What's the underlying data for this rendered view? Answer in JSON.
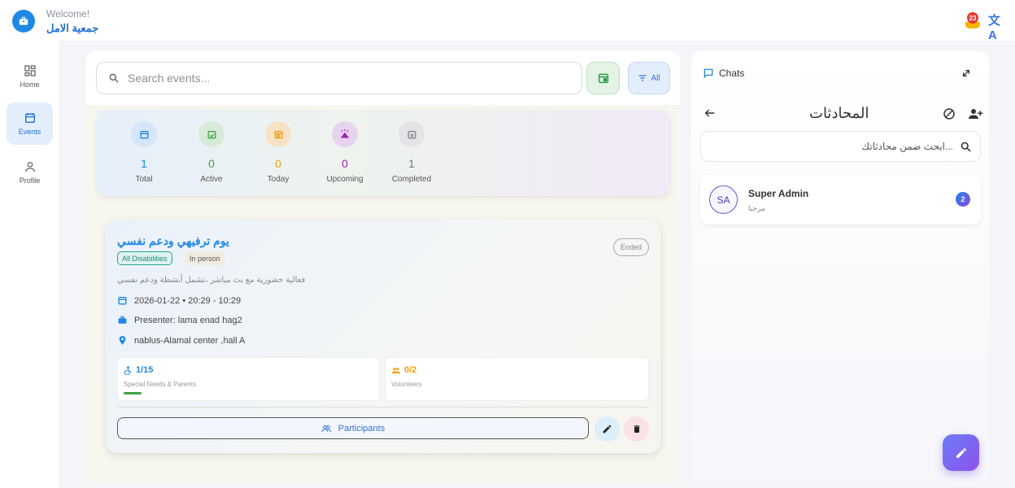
{
  "header": {
    "welcome": "Welcome!",
    "org_name": "جمعية الامل",
    "notification_count": "23",
    "translate_label": "文A"
  },
  "nav": {
    "items": [
      {
        "label": "Home",
        "icon": "dashboard-icon"
      },
      {
        "label": "Events",
        "icon": "calendar-icon",
        "active": true
      },
      {
        "label": "Profile",
        "icon": "person-icon"
      }
    ]
  },
  "events": {
    "search_placeholder": "Search events...",
    "filter_label": "All",
    "stats": [
      {
        "value": "1",
        "label": "Total",
        "color": "#1e88e5",
        "bg": "#d6e6fa"
      },
      {
        "value": "0",
        "label": "Active",
        "color": "#43a047",
        "bg": "#d7ecd8"
      },
      {
        "value": "0",
        "label": "Today",
        "color": "#f59e0b",
        "bg": "#f6e3c6"
      },
      {
        "value": "0",
        "label": "Upcoming",
        "color": "#9c27b0",
        "bg": "#e8d3ef"
      },
      {
        "value": "1",
        "label": "Completed",
        "color": "#777777",
        "bg": "#e4e4e8"
      }
    ],
    "card": {
      "title": "يوم ترفيهي ودعم نفسي",
      "status": "Ended",
      "tags": [
        "All Disabilities",
        "In person"
      ],
      "description": "فعالية حضورية مع بث مباشر ،تشمل أنشطة ودعم نفسي",
      "datetime": "2026-01-22 • 20:29 - 10:29",
      "presenter": "Presenter: lama enad hag2",
      "location": "nablus-Alamal center ,hall A",
      "special_needs": {
        "value": "1/15",
        "label": "Special Needs & Parents",
        "filled_fraction": 0.07
      },
      "volunteers": {
        "value": "0/2",
        "label": "Volunteers"
      },
      "participants_label": "Participants"
    }
  },
  "chats": {
    "header": "Chats",
    "title": "المحادثات",
    "search_placeholder": "...ابحث ضمن محادثاتك",
    "conversations": [
      {
        "initials": "SA",
        "name": "Super Admin",
        "preview": "مرحبا",
        "unread": "2"
      }
    ]
  }
}
